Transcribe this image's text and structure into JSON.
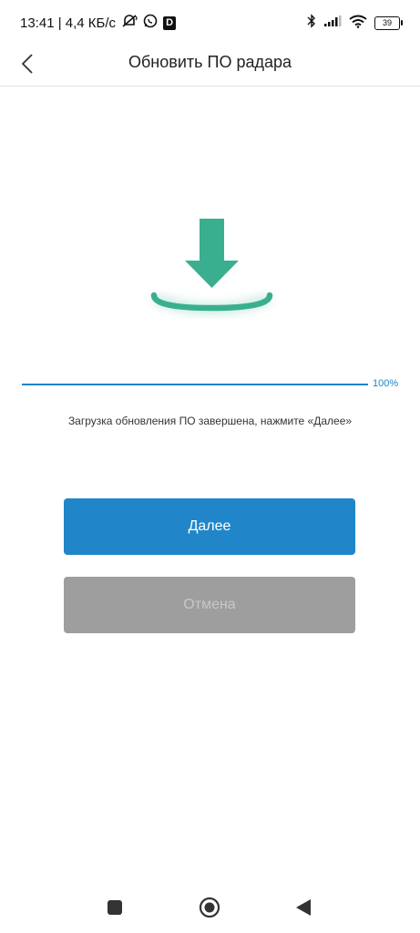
{
  "status_bar": {
    "time_speed": "13:41 | 4,4 КБ/с",
    "badge_letter": "D",
    "battery": "39",
    "icons": [
      "muted-bell-icon",
      "whatsapp-icon",
      "d-app-icon",
      "bluetooth-icon",
      "signal-icon",
      "wifi-icon",
      "battery-icon"
    ]
  },
  "header": {
    "title": "Обновить ПО радара",
    "back_icon": "chevron-left-icon"
  },
  "illustration": {
    "icon": "download-icon",
    "color": "#3aaf8f"
  },
  "progress": {
    "value": 1.0,
    "label": "100%",
    "color": "#2184c8"
  },
  "message": "Загрузка обновления ПО завершена, нажмите «Далее»",
  "buttons": {
    "next_label": "Далее",
    "cancel_label": "Отмена"
  },
  "colors": {
    "primary": "#2186c9",
    "disabled": "#9e9e9e",
    "accent_green": "#3aaf8f"
  },
  "nav_bar": {
    "icons": [
      "square-recents-icon",
      "circle-home-icon",
      "triangle-back-icon"
    ]
  }
}
